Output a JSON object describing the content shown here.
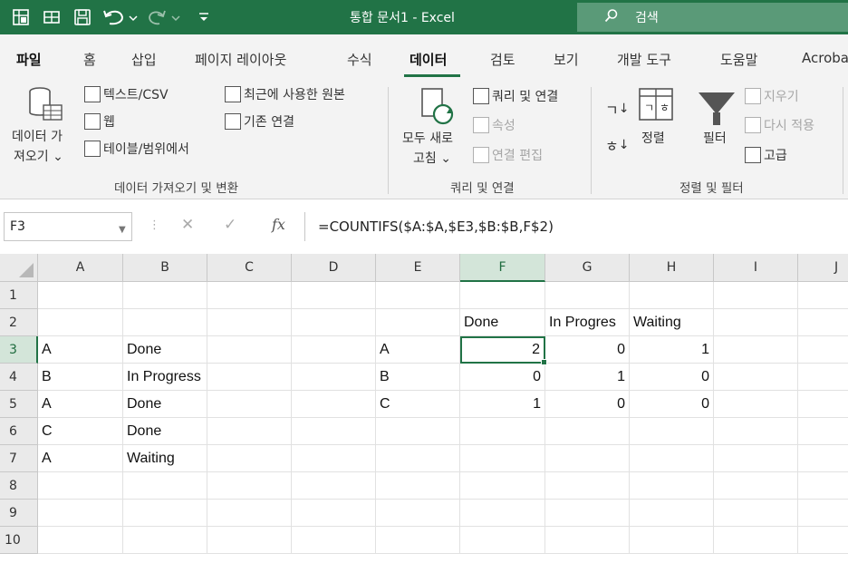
{
  "quick_access": {
    "autosave_icon": "autosave-icon",
    "save_icon": "save-icon",
    "undo_icon": "undo-icon",
    "redo_icon": "redo-icon",
    "customize_icon": "customize-qat-icon"
  },
  "title": {
    "doc_name": "통합 문서1  -  Excel"
  },
  "search": {
    "label": "검색",
    "icon": "search-icon"
  },
  "ribbon_tabs": [
    {
      "label": "파일",
      "bold": true
    },
    {
      "label": "홈"
    },
    {
      "label": "삽입"
    },
    {
      "label": "페이지 레이아웃"
    },
    {
      "label": "수식"
    },
    {
      "label": "데이터",
      "bold": true,
      "active": true
    },
    {
      "label": "검토"
    },
    {
      "label": "보기"
    },
    {
      "label": "개발 도구"
    },
    {
      "label": "도움말"
    },
    {
      "label": "Acroba"
    }
  ],
  "ribbon": {
    "get_data": {
      "big_button_line1": "데이터 가",
      "big_button_line2": "져오기 ⌄",
      "from_text_csv": "텍스트/CSV",
      "from_web": "웹",
      "from_table_range": "테이블/범위에서",
      "recent_sources": "최근에 사용한 원본",
      "existing_connections": "기존 연결",
      "group_label": "데이터 가져오기 및 변환"
    },
    "queries": {
      "refresh_all_line1": "모두 새로",
      "refresh_all_line2": "고침 ⌄",
      "queries_connections": "쿼리 및 연결",
      "properties": "속성",
      "edit_links": "연결 편집",
      "group_label": "쿼리 및 연결"
    },
    "sort_filter": {
      "sort_az": "↓",
      "sort_za": "↓",
      "sort": "정렬",
      "filter": "필터",
      "clear": "지우기",
      "reapply": "다시 적용",
      "advanced": "고급",
      "group_label": "정렬 및 필터"
    }
  },
  "formula_bar": {
    "name_box": "F3",
    "formula": "=COUNTIFS($A:$A,$E3,$B:$B,F$2)"
  },
  "grid": {
    "columns": [
      "A",
      "B",
      "C",
      "D",
      "E",
      "F",
      "G",
      "H",
      "I",
      "J"
    ],
    "rows": [
      "1",
      "2",
      "3",
      "4",
      "5",
      "6",
      "7",
      "8",
      "9",
      "10"
    ],
    "active_cell": "F3",
    "cells": {
      "F2": "Done",
      "G2": "In Progres",
      "H2": "Waiting",
      "A3": "A",
      "B3": "Done",
      "E3": "A",
      "F3": "2",
      "G3": "0",
      "H3": "1",
      "A4": "B",
      "B4": "In Progress",
      "E4": "B",
      "F4": "0",
      "G4": "1",
      "H4": "0",
      "A5": "A",
      "B5": "Done",
      "E5": "C",
      "F5": "1",
      "G5": "0",
      "H5": "0",
      "A6": "C",
      "B6": "Done",
      "A7": "A",
      "B7": "Waiting"
    }
  },
  "colors": {
    "excel_green": "#217346",
    "ribbon_bg": "#f3f3f3",
    "header_bg": "#eaeaea",
    "selected_header_bg": "#d3e5d9"
  }
}
